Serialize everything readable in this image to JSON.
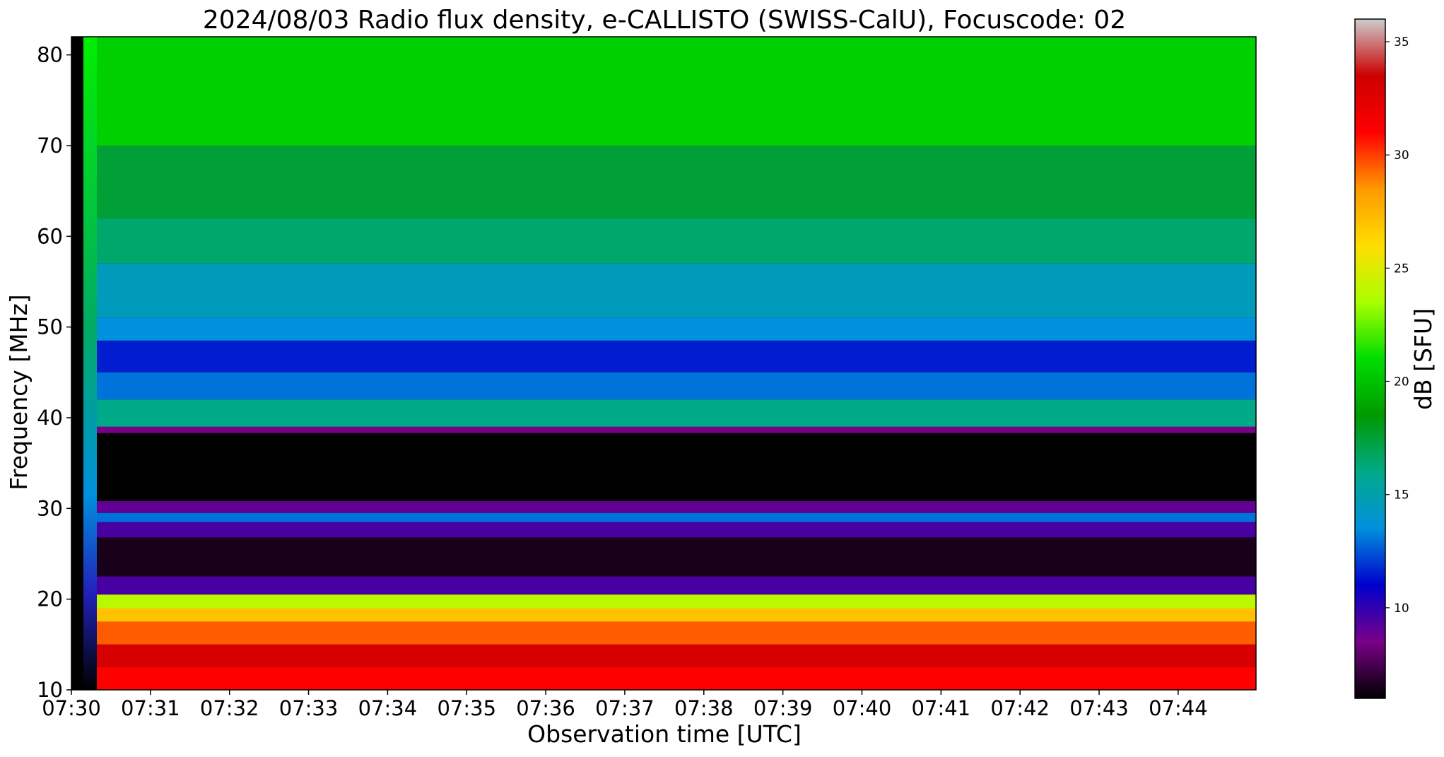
{
  "chart_data": {
    "type": "heatmap",
    "title": "2024/08/03  Radio flux density, e-CALLISTO (SWISS-CalU), Focuscode: 02",
    "xlabel": "Observation time [UTC]",
    "ylabel": "Frequency [MHz]",
    "x_ticks": [
      "07:30",
      "07:31",
      "07:32",
      "07:33",
      "07:34",
      "07:35",
      "07:36",
      "07:37",
      "07:38",
      "07:39",
      "07:40",
      "07:41",
      "07:42",
      "07:43",
      "07:44"
    ],
    "x_range": [
      "07:30",
      "07:44:55"
    ],
    "y_ticks": [
      10,
      20,
      30,
      40,
      50,
      60,
      70,
      80
    ],
    "ylim": [
      10,
      82
    ],
    "colorbar": {
      "label": "dB [SFU]",
      "ticks": [
        10,
        15,
        20,
        25,
        30,
        35
      ],
      "range": [
        6,
        36
      ],
      "colormap": "spectral",
      "stops": [
        "#000000",
        "#7a0088",
        "#0000cc",
        "#0090dd",
        "#00aa88",
        "#009900",
        "#00dd00",
        "#aaff00",
        "#ffdd00",
        "#ff9900",
        "#ff0000",
        "#cc0000",
        "#cccccc"
      ]
    },
    "bands": [
      {
        "f_lo": 70,
        "f_hi": 82,
        "db": 20.5
      },
      {
        "f_lo": 62,
        "f_hi": 70,
        "db": 17.5
      },
      {
        "f_lo": 57,
        "f_hi": 62,
        "db": 16.5
      },
      {
        "f_lo": 51,
        "f_hi": 57,
        "db": 14.5
      },
      {
        "f_lo": 48.5,
        "f_hi": 51,
        "db": 13.5
      },
      {
        "f_lo": 45,
        "f_hi": 48.5,
        "db": 11.5
      },
      {
        "f_lo": 42,
        "f_hi": 45,
        "db": 13
      },
      {
        "f_lo": 39,
        "f_hi": 42,
        "db": 16
      },
      {
        "f_lo": 38.3,
        "f_hi": 39,
        "db": 8.5
      },
      {
        "f_lo": 30.8,
        "f_hi": 38.3,
        "db": 6
      },
      {
        "f_lo": 29.5,
        "f_hi": 30.8,
        "db": 9
      },
      {
        "f_lo": 28.5,
        "f_hi": 29.5,
        "db": 13
      },
      {
        "f_lo": 26.8,
        "f_hi": 28.5,
        "db": 9.5
      },
      {
        "f_lo": 22.5,
        "f_hi": 26.8,
        "db": 6.5
      },
      {
        "f_lo": 20.5,
        "f_hi": 22.5,
        "db": 9.5
      },
      {
        "f_lo": 19,
        "f_hi": 20.5,
        "db": 24
      },
      {
        "f_lo": 17.5,
        "f_hi": 19,
        "db": 27
      },
      {
        "f_lo": 15,
        "f_hi": 17.5,
        "db": 29.5
      },
      {
        "f_lo": 12.5,
        "f_hi": 15,
        "db": 33
      },
      {
        "f_lo": 10,
        "f_hi": 12.5,
        "db": 31
      }
    ]
  }
}
